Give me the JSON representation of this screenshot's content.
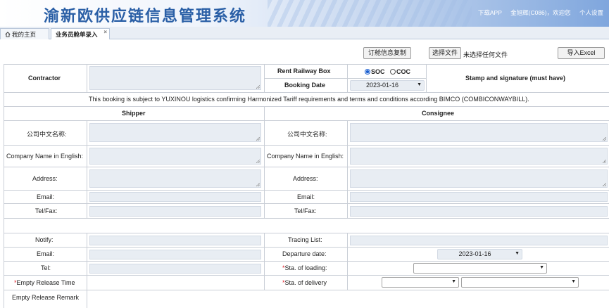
{
  "header": {
    "title": "渝新欧供应链信息管理系统",
    "links": [
      "下载APP",
      "金旭辉(C086)，欢迎您",
      "个人设置"
    ]
  },
  "tabs": [
    {
      "label": "我的主页"
    },
    {
      "label": "业务员舱单录入",
      "close": "×"
    }
  ],
  "toolbar": {
    "copy_label": "订舱信息复制",
    "choose_file_label": "选择文件",
    "no_file_text": "未选择任何文件",
    "import_label": "导入Excel"
  },
  "form": {
    "contractor": "Contractor",
    "rent_railway_box": "Rent Railway Box",
    "soc": "SOC",
    "coc": "COC",
    "stamp": "Stamp and signature (must have)",
    "booking_date_label": "Booking Date",
    "booking_date": "2023-01-16",
    "notice": "This booking is subject to YUXINOU logistics confirming Harmonized Tariff requirements and terms and conditions according BIMCO (COMBICONWAYBILL).",
    "shipper": "Shipper",
    "consignee": "Consignee",
    "cn_name": "公司中文名称:",
    "en_name": "Company Name in English:",
    "address": "Address:",
    "email": "Email:",
    "telfax": "Tel/Fax:",
    "notify": "Notify:",
    "tracing_list": "Tracing List:",
    "departure_label": "Departure date:",
    "departure_date": "2023-01-16",
    "tel": "Tel:",
    "sta_loading": "Sta. of loading:",
    "empty_release_time": "Empty Release Time",
    "sta_delivery": "Sta. of delivery",
    "empty_release_remark": "Empty Release Remark",
    "required_mark": "*"
  },
  "colors": {
    "title": "#2a5fa6",
    "field_bg": "#e8edf3",
    "required": "#e0202a"
  }
}
